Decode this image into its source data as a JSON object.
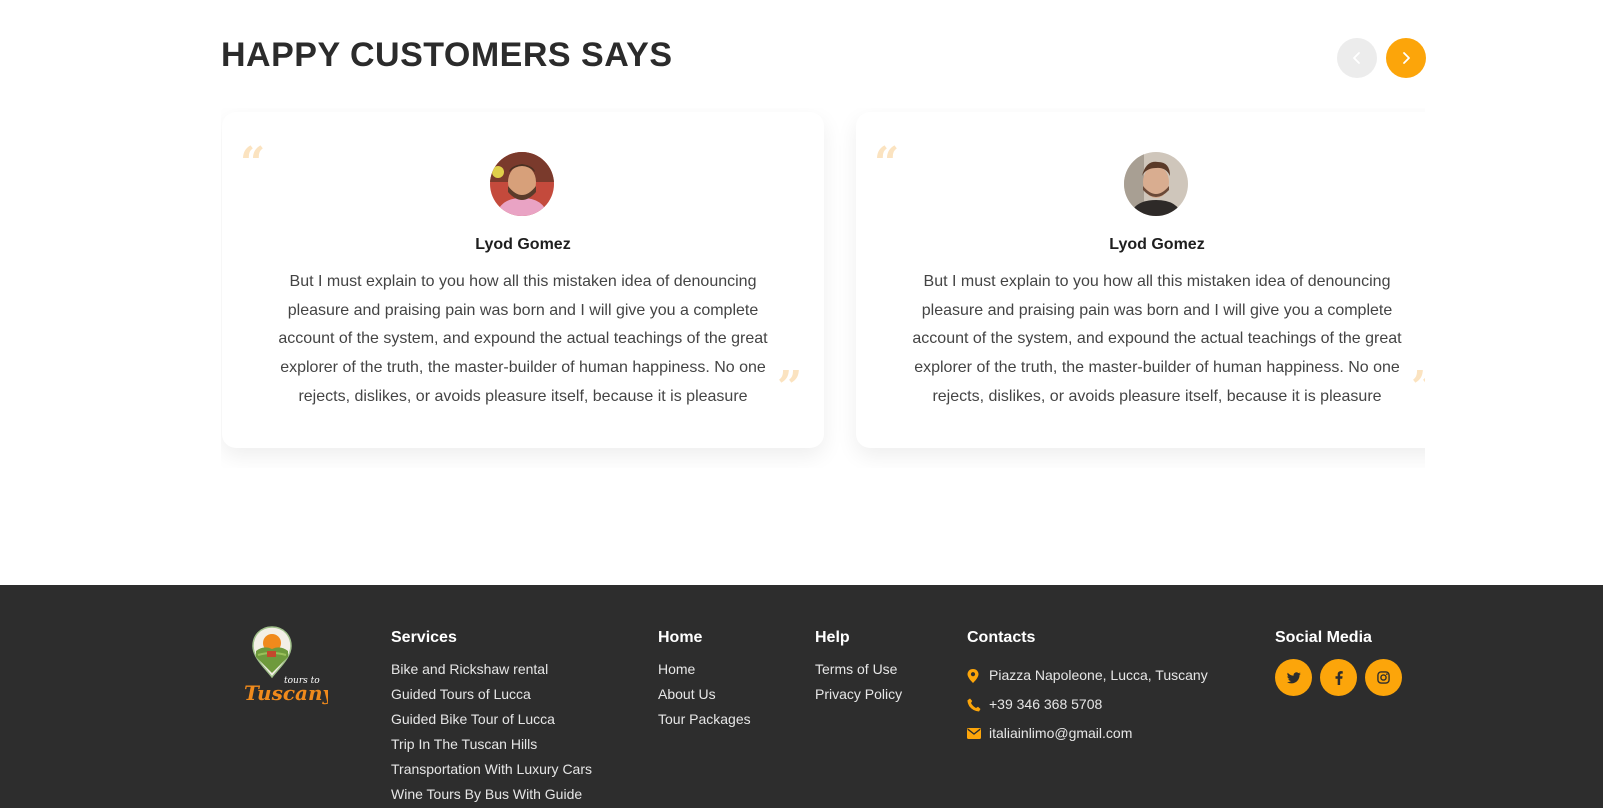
{
  "testimonials": {
    "title": "HAPPY CUSTOMERS SAYS",
    "quote_open": "“",
    "quote_close": "”",
    "nav_prev_icon": "chevron-left-icon",
    "nav_next_icon": "chevron-right-icon",
    "items": [
      {
        "name": "Lyod Gomez",
        "text": "But I must explain to you how all this mistaken idea of denouncing pleasure and praising pain was born and I will give you a complete account of the system, and expound the actual teachings of the great explorer of the truth, the master-builder of human happiness. No one rejects, dislikes, or avoids pleasure itself, because it is pleasure"
      },
      {
        "name": "Lyod Gomez",
        "text": "But I must explain to you how all this mistaken idea of denouncing pleasure and praising pain was born and I will give you a complete account of the system, and expound the actual teachings of the great explorer of the truth, the master-builder of human happiness. No one rejects, dislikes, or avoids pleasure itself, because it is pleasure"
      }
    ]
  },
  "footer": {
    "logo_text_small": "tours to",
    "logo_text_big": "Tuscany",
    "services": {
      "title": "Services",
      "items": [
        "Bike and Rickshaw rental",
        "Guided Tours of Lucca",
        "Guided Bike Tour of Lucca",
        "Trip In The Tuscan Hills",
        "Transportation With Luxury Cars",
        "Wine Tours By Bus With Guide"
      ]
    },
    "home": {
      "title": "Home",
      "items": [
        "Home",
        "About Us",
        "Tour Packages"
      ]
    },
    "help": {
      "title": "Help",
      "items": [
        "Terms of Use",
        "Privacy Policy"
      ]
    },
    "contacts": {
      "title": "Contacts",
      "address": "Piazza Napoleone, Lucca, Tuscany",
      "phone": "+39 346 368 5708",
      "email": "italiainlimo@gmail.com"
    },
    "social": {
      "title": "Social Media",
      "icons": [
        "twitter-icon",
        "facebook-icon",
        "instagram-icon"
      ]
    }
  },
  "colors": {
    "accent": "#fca50a",
    "footer_bg": "#2d2d2d",
    "quote_mark": "#fbe3c0"
  }
}
